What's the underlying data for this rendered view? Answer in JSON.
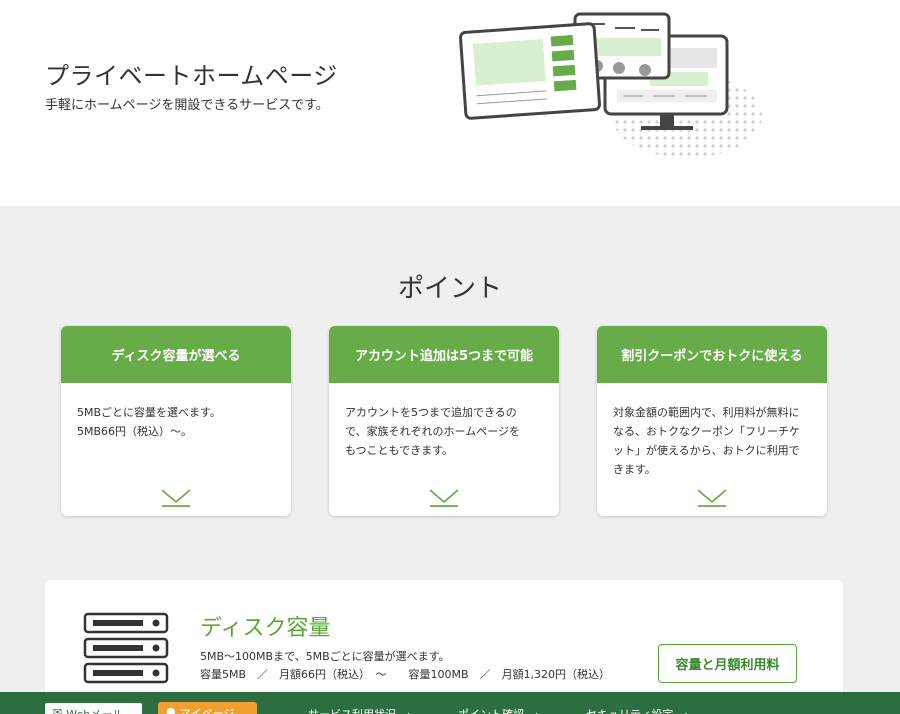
{
  "hero": {
    "title": "プライベートホームページ",
    "subtitle": "手軽にホームページを開設できるサービスです。"
  },
  "points": {
    "title": "ポイント",
    "cards": [
      {
        "title": "ディスク容量が選べる",
        "body": "5MBごとに容量を選べます。\n5MB66円（税込）～。"
      },
      {
        "title": "アカウント追加は5つまで可能",
        "body": "アカウントを5つまで追加できるの\nで、家族それぞれのホームページを\nもつこともできます。"
      },
      {
        "title": "割引クーポンでおトクに使える",
        "body": "対象金額の範囲内で、利用料が無料に\nなる、おトクなクーポン「フリーチケ\nット」が使えるから、おトクに利用で\nきます。"
      }
    ]
  },
  "disk": {
    "title": "ディスク容量",
    "line1": "5MB～100MBまで、5MBごとに容量が選べます。",
    "line2": "容量5MB　／　月額66円（税込）　～　　容量100MB　／　月額1,320円（税込）",
    "button": "容量と月額利用料"
  },
  "footer": {
    "webmail": "Webメール",
    "mypage": "マイページ",
    "links": [
      "サービス利用状況　›",
      "ポイント確認　›",
      "セキュリティ設定　›"
    ]
  },
  "colors": {
    "accent_green": "#67ac48",
    "footer_green": "#2b6e3f",
    "orange": "#f0a030"
  },
  "icons": [
    "chevron-down-icon",
    "server-icon",
    "mail-icon",
    "person-icon"
  ]
}
